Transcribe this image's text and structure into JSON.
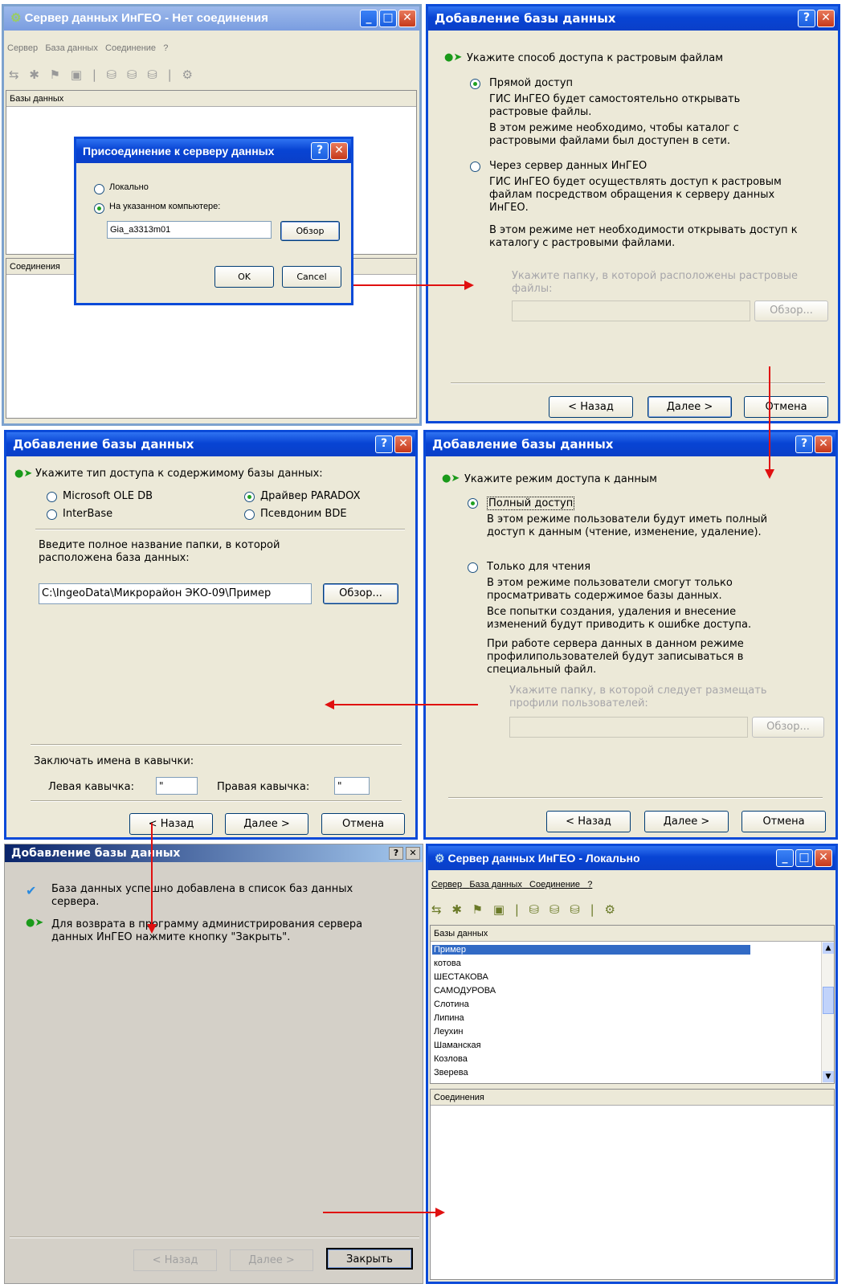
{
  "w1": {
    "title": "Сервер данных ИнГЕО - Нет соединения",
    "menu": [
      "Сервер",
      "База данных",
      "Соединение",
      "?"
    ],
    "db_header": "Базы данных",
    "conn_header": "Соединения",
    "dialog": {
      "title": "Присоединение к серверу данных",
      "radio_local": "Локально",
      "radio_remote": "На указанном компьютере:",
      "computer": "Gia_a3313m01",
      "browse": "Обзор",
      "ok": "OK",
      "cancel": "Cancel"
    }
  },
  "w2": {
    "title": "Добавление базы данных",
    "instruction": "Укажите способ доступа к растровым файлам",
    "opt1": "Прямой доступ",
    "opt1_l1": "ГИС ИнГЕО будет самостоятельно открывать",
    "opt1_l2": "растровые файлы.",
    "opt1_l3": "В этом режиме необходимо, чтобы каталог с",
    "opt1_l4": "растровыми файлами был доступен в сети.",
    "opt2": "Через сервер данных ИнГЕО",
    "opt2_l1": "ГИС ИнГЕО будет осуществлять доступ к растровым",
    "opt2_l2": "файлам посредством обращения к серверу данных",
    "opt2_l3": "ИнГЕО.",
    "opt2_l4": "В этом режиме нет необходимости открывать доступ к",
    "opt2_l5": "каталогу с растровыми файлами.",
    "folder_l1": "Укажите папку, в которой расположены растровые",
    "folder_l2": "файлы:",
    "browse": "Обзор...",
    "back": "< Назад",
    "next": "Далее >",
    "cancel": "Отмена"
  },
  "w3": {
    "title": "Добавление базы данных",
    "instruction": "Укажите тип доступа к содержимому базы данных:",
    "r1": "Microsoft OLE DB",
    "r2": "Драйвер PARADOX",
    "r3": "InterBase",
    "r4": "Псевдоним BDE",
    "folder_l1": "Введите полное название папки, в которой",
    "folder_l2": "расположена база данных:",
    "path": "C:\\IngeoData\\Микрорайон ЭКО-09\\Пример",
    "browse": "Обзор...",
    "quotes": "Заключать имена в кавычки:",
    "left_q": "Левая кавычка:",
    "left_v": "\"",
    "right_q": "Правая кавычка:",
    "right_v": "\"",
    "back": "< Назад",
    "next": "Далее >",
    "cancel": "Отмена"
  },
  "w4": {
    "title": "Добавление базы данных",
    "instruction": "Укажите режим доступа к данным",
    "opt1": "Полный доступ",
    "opt1_l1": "В этом режиме пользователи будут иметь полный",
    "opt1_l2": "доступ к данным (чтение, изменение, удаление).",
    "opt2": "Только для чтения",
    "opt2_l1": "В этом режиме пользователи смогут только",
    "opt2_l2": "просматривать содержимое базы данных.",
    "opt2_l3": "Все попытки создания, удаления и внесение",
    "opt2_l4": "изменений будут приводить к ошибке доступа.",
    "opt2_l5": "При работе сервера данных в данном режиме",
    "opt2_l6": "профилипользователей будут записываться в",
    "opt2_l7": "специальный файл.",
    "folder_l1": "Укажите папку, в которой следует размещать",
    "folder_l2": "профили пользователей:",
    "browse": "Обзор...",
    "back": "< Назад",
    "next": "Далее >",
    "cancel": "Отмена"
  },
  "w5": {
    "title": "Добавление базы данных",
    "msg1_l1": "База данных успешно добавлена в список баз данных",
    "msg1_l2": "сервера.",
    "msg2_l1": "Для возврата в программу администрирования сервера",
    "msg2_l2": "данных ИнГЕО нажмите кнопку \"Закрыть\".",
    "back": "< Назад",
    "next": "Далее >",
    "close": "Закрыть"
  },
  "w6": {
    "title": "Сервер данных ИнГЕО - Локально",
    "menu": [
      "Сервер",
      "База данных",
      "Соединение",
      "?"
    ],
    "db_header": "Базы данных",
    "databases": [
      "Пример",
      "котова",
      "ШЕСТАКОВА",
      "САМОДУРОВА",
      "Слотина",
      "Липина",
      "Леухин",
      "Шаманская",
      "Козлова",
      "Зверева"
    ],
    "conn_header": "Соединения"
  },
  "colors": {
    "titlebar": "#0a4ad8",
    "dialog_bg": "#ece9d8",
    "arrow": "#e01010",
    "selection": "#316ac5"
  }
}
